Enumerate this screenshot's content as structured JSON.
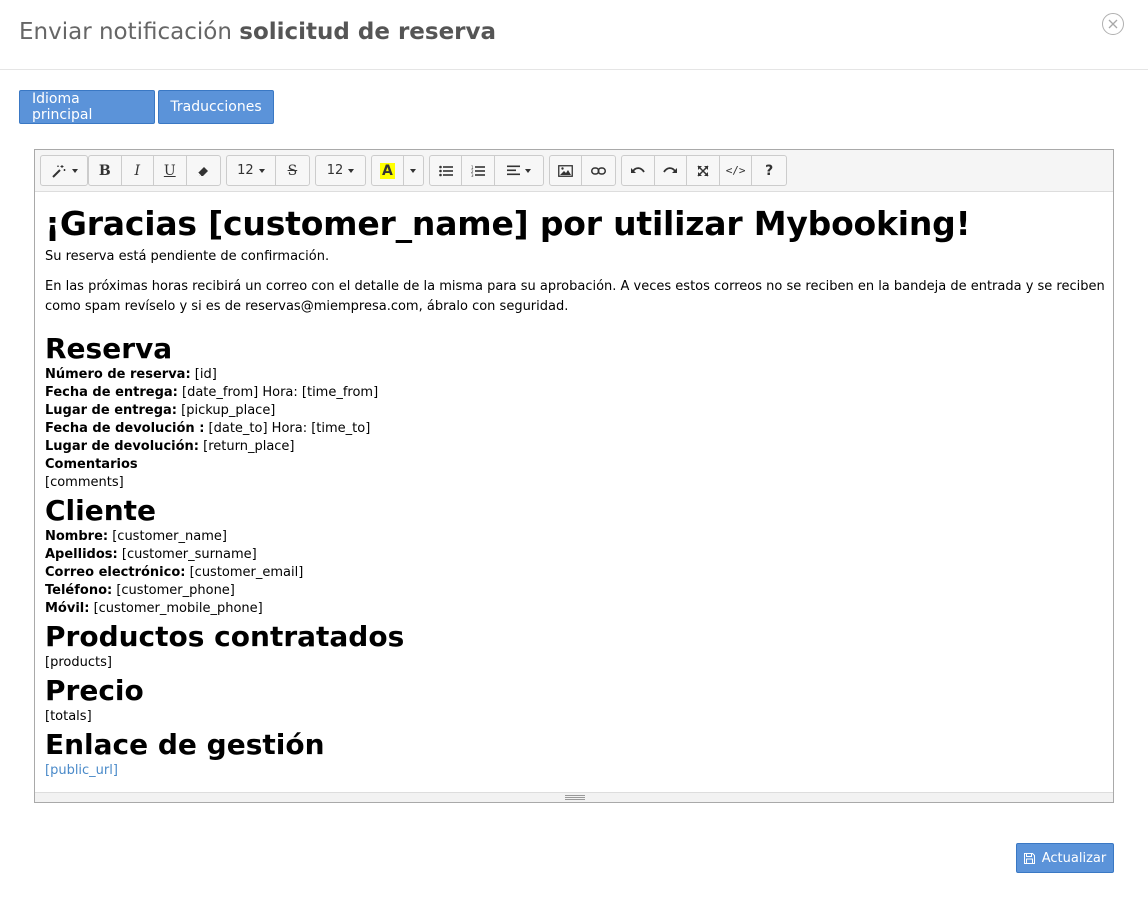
{
  "modal": {
    "title_prefix": "Enviar notificación",
    "title_strong": "solicitud de reserva"
  },
  "tabs": [
    {
      "label": "Idioma principal"
    },
    {
      "label": "Traducciones"
    }
  ],
  "toolbar": {
    "font_size_1": "12",
    "font_size_2": "12",
    "bold": "B",
    "italic": "I",
    "underline": "U",
    "strike": "S",
    "color_letter": "A",
    "help": "?",
    "code": "</>"
  },
  "content": {
    "heading": "¡Gracias [customer_name] por utilizar Mybooking!",
    "status": "Su reserva está pendiente de confirmación.",
    "intro": "En las próximas horas recibirá un correo con el detalle de la misma para su aprobación. A veces estos correos no se reciben en la bandeja de entrada y se reciben como spam revíselo y si es de reservas@miempresa.com, ábralo con seguridad.",
    "reserva": {
      "title": "Reserva",
      "lines": [
        {
          "label": "Número de reserva:",
          "value": " [id]"
        },
        {
          "label": "Fecha de entrega:",
          "value": " [date_from] Hora: [time_from]"
        },
        {
          "label": "Lugar de entrega:",
          "value": " [pickup_place]"
        },
        {
          "label": "Fecha de devolución :",
          "value": " [date_to] Hora: [time_to]"
        },
        {
          "label": "Lugar de devolución:",
          "value": " [return_place]"
        }
      ],
      "comments_label": "Comentarios",
      "comments_value": "[comments]"
    },
    "cliente": {
      "title": "Cliente",
      "lines": [
        {
          "label": "Nombre:",
          "value": " [customer_name]"
        },
        {
          "label": "Apellidos:",
          "value": " [customer_surname]"
        },
        {
          "label": "Correo electrónico:",
          "value": " [customer_email]"
        },
        {
          "label": "Teléfono:",
          "value": " [customer_phone]"
        },
        {
          "label": "Móvil:",
          "value": " [customer_mobile_phone]"
        }
      ]
    },
    "productos": {
      "title": "Productos contratados",
      "value": "[products]"
    },
    "precio": {
      "title": "Precio",
      "value": "[totals]"
    },
    "enlace": {
      "title": "Enlace de gestión",
      "value": "[public_url]"
    }
  },
  "footer": {
    "update_label": "Actualizar"
  },
  "colors": {
    "primary": "#5b93d9",
    "link": "#4a8ac9",
    "highlight": "#ffff00"
  }
}
